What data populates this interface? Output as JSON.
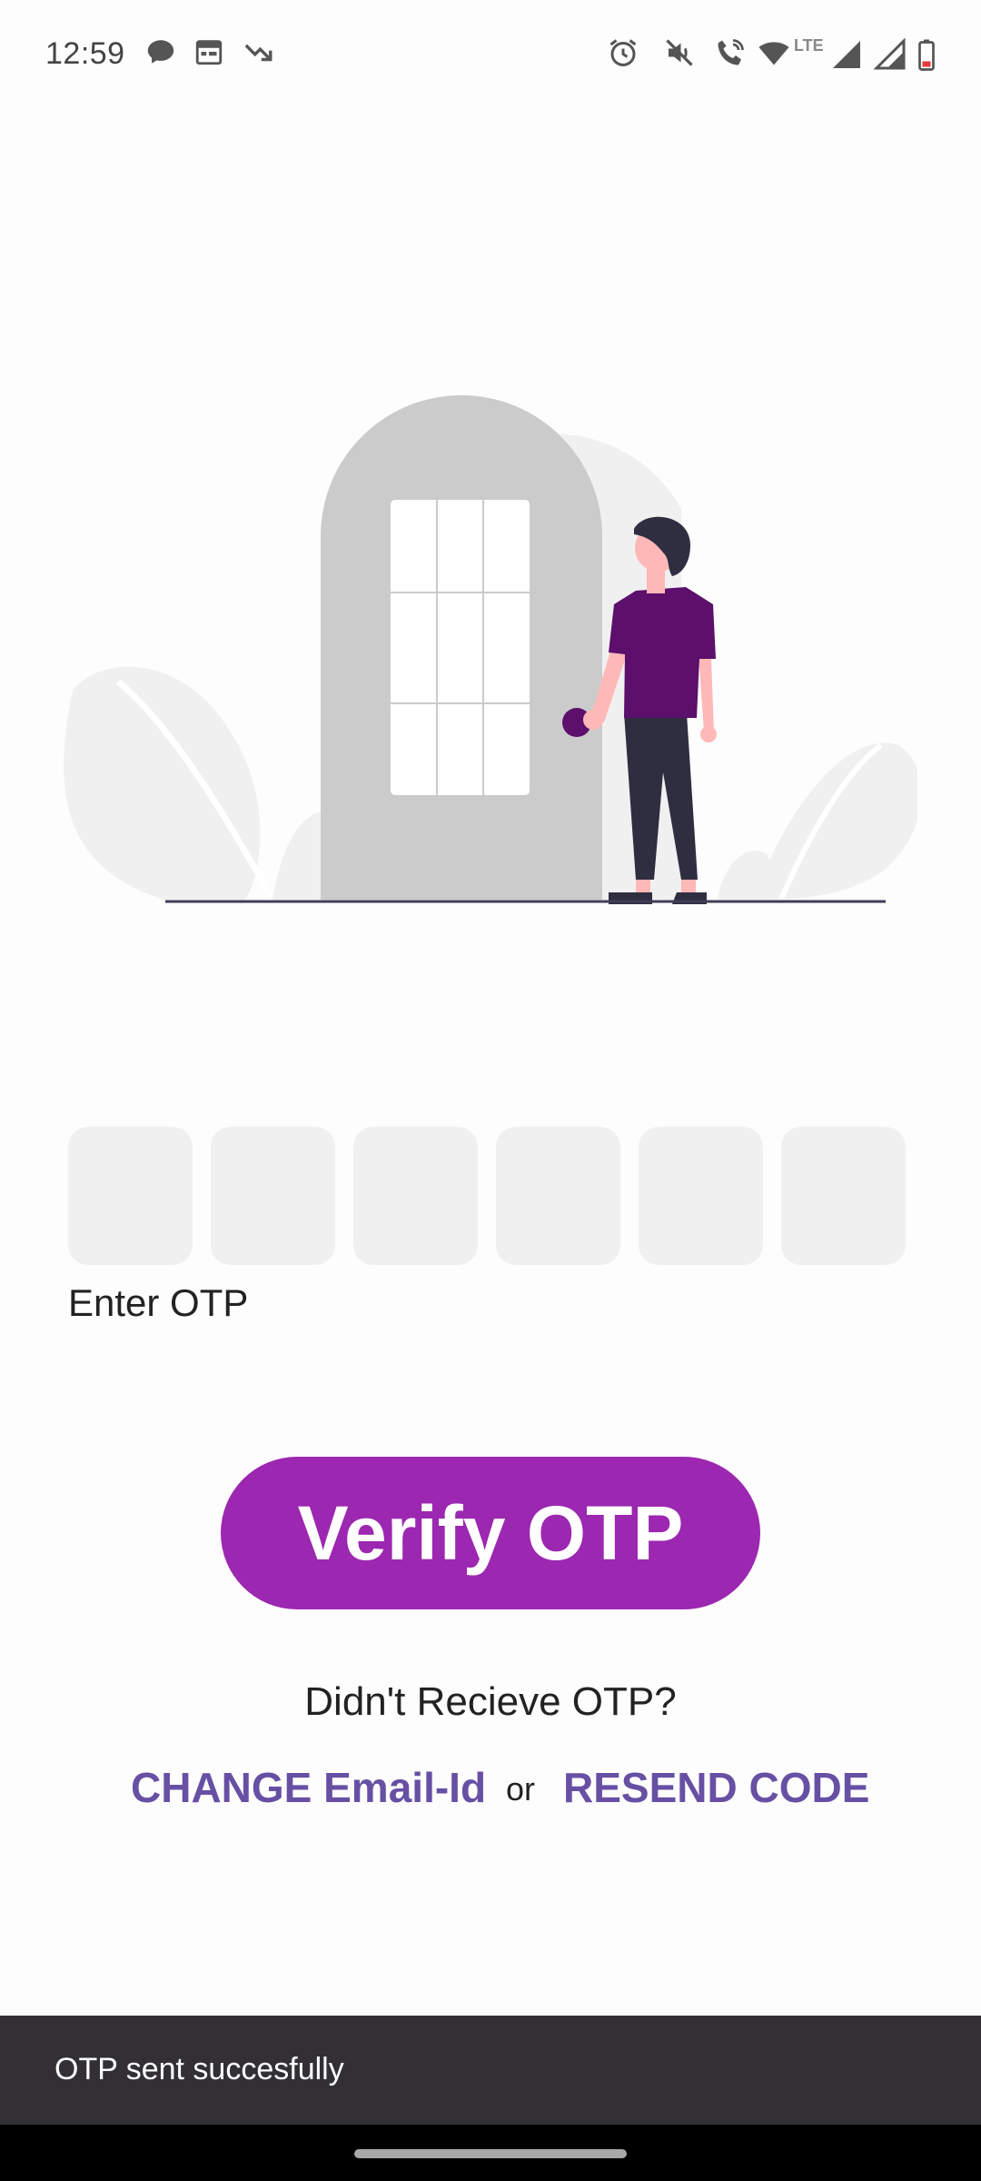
{
  "status_bar": {
    "time": "12:59",
    "left_icons": [
      "chat-bubble-icon",
      "calendar-icon",
      "trending-down-icon"
    ],
    "right_icons": [
      "alarm-icon",
      "mute-icon",
      "wifi-call-icon",
      "wifi-icon",
      "signal-lte-icon",
      "signal-icon",
      "battery-low-icon"
    ],
    "network_label": "LTE"
  },
  "illustration": {
    "name": "door-person-illustration",
    "colors": {
      "door": "#cbcbcb",
      "backdrop": "#f0f0f0",
      "shirt": "#5c0f6b",
      "pants": "#2f2e41",
      "skin": "#ffb8b8",
      "ground_line": "#3f3d56"
    }
  },
  "otp": {
    "box_count": 6,
    "values": [
      "",
      "",
      "",
      "",
      "",
      ""
    ],
    "label": "Enter OTP"
  },
  "actions": {
    "verify_label": "Verify OTP",
    "didnt_receive": "Didn't Recieve OTP?",
    "change_email": "CHANGE Email-Id",
    "or": "or",
    "resend": "RESEND CODE"
  },
  "snackbar": {
    "message": "OTP sent succesfully"
  },
  "colors": {
    "accent": "#9c27b0",
    "link": "#6750a4",
    "snackbar_bg": "#323035"
  }
}
